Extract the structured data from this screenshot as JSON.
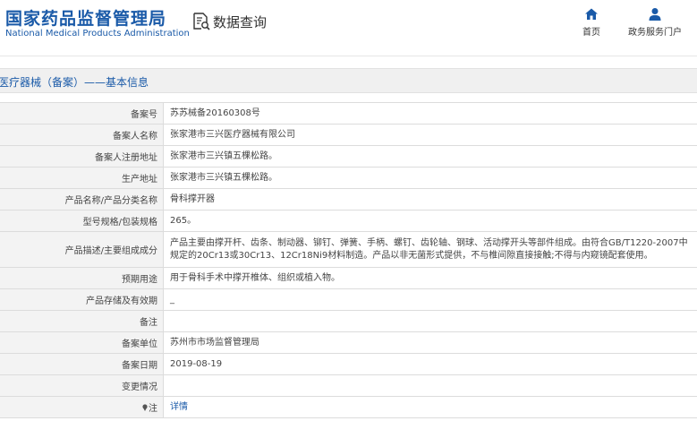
{
  "header": {
    "logo_cn": "国家药品监督管理局",
    "logo_en": "National Medical Products Administration",
    "query_label": "数据查询",
    "nav": {
      "home_label": "首页",
      "portal_label": "政务服务门户"
    }
  },
  "breadcrumb": "医疗器械（备案）——基本信息",
  "detail_rows": [
    {
      "label": "备案号",
      "value": "苏苏械备20160308号"
    },
    {
      "label": "备案人名称",
      "value": "张家港市三兴医疗器械有限公司"
    },
    {
      "label": "备案人注册地址",
      "value": "张家港市三兴镇五棵松路。"
    },
    {
      "label": "生产地址",
      "value": "张家港市三兴镇五棵松路。"
    },
    {
      "label": "产品名称/产品分类名称",
      "value": "骨科撑开器"
    },
    {
      "label": "型号规格/包装规格",
      "value": "265。"
    },
    {
      "label": "产品描述/主要组成成分",
      "value": "产品主要由撑开杆、齿条、制动器、铆钉、弹簧、手柄、螺钉、齿轮轴、钢球、活动撑开头等部件组成。由符合GB/T1220-2007中规定的20Cr13或30Cr13、12Cr18Ni9材料制造。产品以非无菌形式提供，不与椎间隙直接接触;不得与内窥镜配套使用。"
    },
    {
      "label": "预期用途",
      "value": "用于骨科手术中撑开椎体、组织或植入物。"
    },
    {
      "label": "产品存储及有效期",
      "value": "_"
    },
    {
      "label": "备注",
      "value": ""
    },
    {
      "label": "备案单位",
      "value": "苏州市市场监督管理局"
    },
    {
      "label": "备案日期",
      "value": "2019-08-19"
    },
    {
      "label": "变更情况",
      "value": ""
    },
    {
      "label": "注",
      "value": "详情"
    }
  ],
  "colors": {
    "brand_blue": "#1a5aa8",
    "label_bg": "#f3f3f3",
    "border": "#dcdcdc"
  },
  "icons": [
    "document-search-icon",
    "home-icon",
    "user-icon",
    "pin-icon"
  ]
}
